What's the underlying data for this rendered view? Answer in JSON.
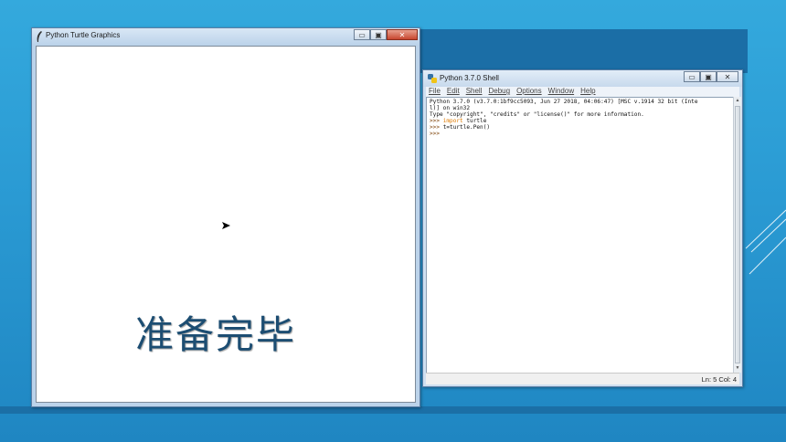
{
  "turtle_window": {
    "title": "Python Turtle Graphics",
    "caption": "准备完毕",
    "controls": {
      "minimize": "▭",
      "maximize": "▣",
      "close": "✕"
    }
  },
  "shell_window": {
    "title": "Python 3.7.0 Shell",
    "menu": [
      "File",
      "Edit",
      "Shell",
      "Debug",
      "Options",
      "Window",
      "Help"
    ],
    "lines": {
      "l1": "Python 3.7.0 (v3.7.0:1bf9cc5093, Jun 27 2018, 04:06:47) [MSC v.1914 32 bit (Inte",
      "l2": "l)] on win32",
      "l3": "Type \"copyright\", \"credits\" or \"license()\" for more information.",
      "prompt": ">>> ",
      "kw_import": "import",
      "l4_rest": " turtle",
      "l5_rest": "t=turtle.Pen()"
    },
    "status": "Ln: 5  Col: 4",
    "controls": {
      "minimize": "▭",
      "maximize": "▣",
      "close": "✕"
    }
  },
  "colors": {
    "slide_background": "#2a9ad3",
    "caption_color": "#1c4d72",
    "keyword_color": "#e07b00"
  },
  "icons": [
    "feather-icon",
    "python-icon",
    "turtle-arrow-icon"
  ]
}
